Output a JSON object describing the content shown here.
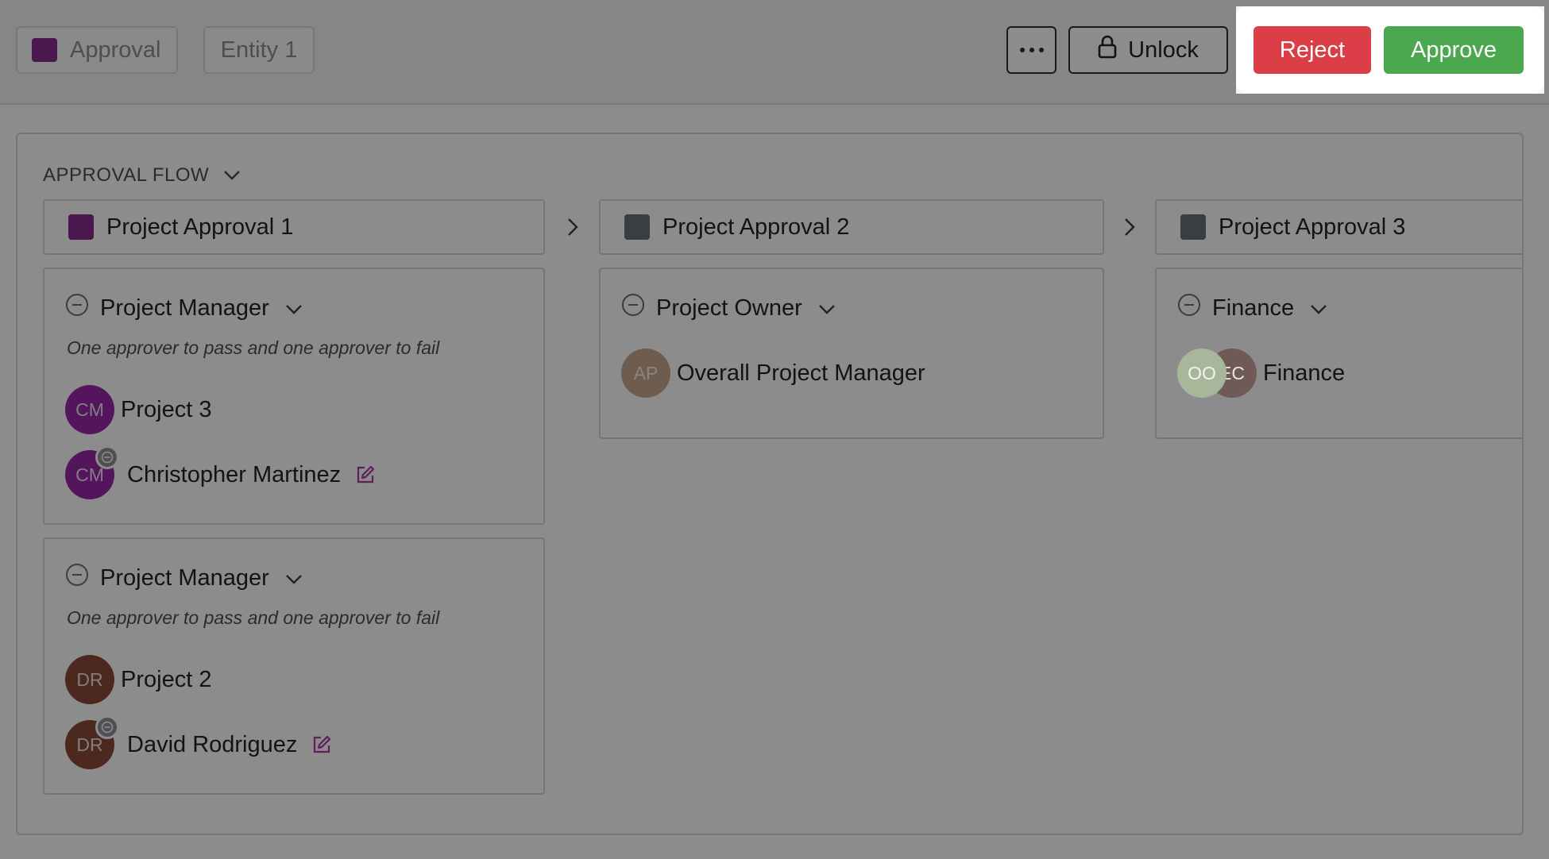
{
  "colors": {
    "purple": "#8b2b91",
    "gray_swatch": "#6b7078",
    "reject": "#dc3e47",
    "approve": "#4ba84e",
    "cm_avatar": "#9c27a8",
    "dr_avatar": "#8b4a3a",
    "ap_avatar": "#c9a98e",
    "oo_avatar": "#a8b79a",
    "ec_avatar": "#6f5a57"
  },
  "toolbar": {
    "approval_chip": "Approval",
    "entity_chip": "Entity 1",
    "unlock_label": "Unlock",
    "reject_label": "Reject",
    "approve_label": "Approve"
  },
  "flow": {
    "title": "APPROVAL FLOW",
    "stages": [
      {
        "name": "Project Approval 1",
        "groups": [
          {
            "role": "Project Manager",
            "rule": "One approver to pass and one approver to fail",
            "group_avatar": "CM",
            "group_name": "Project 3",
            "member_avatar": "CM",
            "member_name": "Christopher Martinez"
          },
          {
            "role": "Project Manager",
            "rule": "One approver to pass and one approver to fail",
            "group_avatar": "DR",
            "group_name": "Project 2",
            "member_avatar": "DR",
            "member_name": "David Rodriguez"
          }
        ]
      },
      {
        "name": "Project Approval 2",
        "groups": [
          {
            "role": "Project Owner",
            "avatar": "AP",
            "name": "Overall Project Manager"
          }
        ]
      },
      {
        "name": "Project Approval 3",
        "groups": [
          {
            "role": "Finance",
            "avatar_1": "OO",
            "avatar_2": "EC",
            "name": "Finance"
          }
        ]
      }
    ]
  }
}
